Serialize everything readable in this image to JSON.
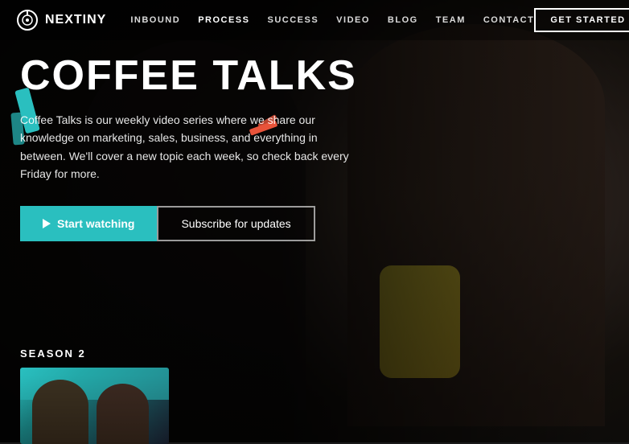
{
  "brand": {
    "name": "NEXTINY",
    "logo_icon": "target-icon"
  },
  "navbar": {
    "links": [
      {
        "label": "INBOUND",
        "id": "inbound",
        "active": false
      },
      {
        "label": "PROCESS",
        "id": "process",
        "active": true
      },
      {
        "label": "SUCCESS",
        "id": "success",
        "active": false
      },
      {
        "label": "VIDEO",
        "id": "video",
        "active": false
      },
      {
        "label": "BLOG",
        "id": "blog",
        "active": false
      },
      {
        "label": "TEAM",
        "id": "team",
        "active": false
      },
      {
        "label": "CONTACT",
        "id": "contact",
        "active": false
      }
    ],
    "cta_label": "GET STARTED"
  },
  "hero": {
    "title": "COFFEE TALKS",
    "description": "Coffee Talks is our weekly video series where we share our knowledge on marketing, sales, business, and everything in between. We'll cover a new topic each week, so check back every Friday for more.",
    "btn_start": "Start watching",
    "btn_subscribe": "Subscribe for updates"
  },
  "season": {
    "label": "SEASON 2"
  }
}
